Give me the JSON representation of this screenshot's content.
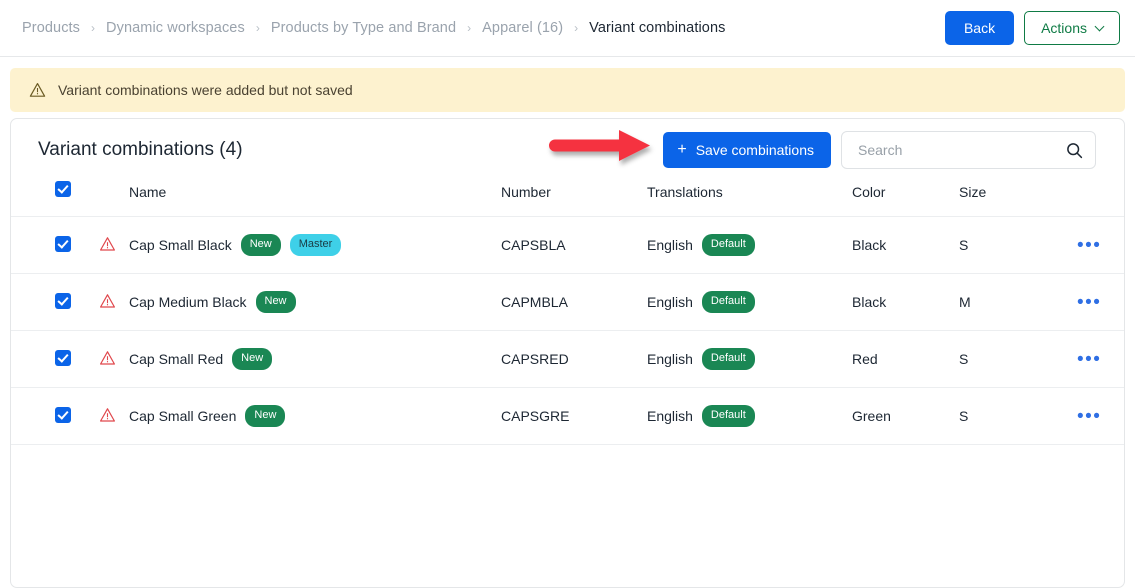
{
  "breadcrumb": {
    "items": [
      {
        "label": "Products",
        "current": false
      },
      {
        "label": "Dynamic workspaces",
        "current": false
      },
      {
        "label": "Products by Type and Brand",
        "current": false
      },
      {
        "label": "Apparel (16)",
        "current": false
      },
      {
        "label": "Variant combinations",
        "current": true
      }
    ],
    "separator": "›"
  },
  "topbar": {
    "back_label": "Back",
    "actions_label": "Actions",
    "chevron_icon": "chevron-down-icon"
  },
  "banner": {
    "icon": "warning-triangle-icon",
    "message": "Variant combinations were added but not saved",
    "background": "#fdf2cf"
  },
  "card": {
    "title": "Variant combinations (4)",
    "save_button": {
      "label": "Save combinations",
      "plus_icon": "plus-icon",
      "color": "#0b64e8"
    },
    "search": {
      "placeholder": "Search",
      "value": "",
      "icon": "search-icon"
    }
  },
  "annotation": {
    "arrow": "red-arrow-pointing-right",
    "color": "#f5333f"
  },
  "table": {
    "select_all_checked": true,
    "columns": [
      "Name",
      "Number",
      "Translations",
      "Color",
      "Size"
    ],
    "rows": [
      {
        "checked": true,
        "warning_icon": "warning-triangle-icon",
        "name": "Cap Small Black",
        "badges": [
          {
            "label": "New",
            "type": "new"
          },
          {
            "label": "Master",
            "type": "master"
          }
        ],
        "number": "CAPSBLA",
        "translation": "English",
        "translation_badge": "Default",
        "color": "Black",
        "size": "S",
        "menu_icon": "overflow-menu-icon"
      },
      {
        "checked": true,
        "warning_icon": "warning-triangle-icon",
        "name": "Cap Medium Black",
        "badges": [
          {
            "label": "New",
            "type": "new"
          }
        ],
        "number": "CAPMBLA",
        "translation": "English",
        "translation_badge": "Default",
        "color": "Black",
        "size": "M",
        "menu_icon": "overflow-menu-icon"
      },
      {
        "checked": true,
        "warning_icon": "warning-triangle-icon",
        "name": "Cap Small Red",
        "badges": [
          {
            "label": "New",
            "type": "new"
          }
        ],
        "number": "CAPSRED",
        "translation": "English",
        "translation_badge": "Default",
        "color": "Red",
        "size": "S",
        "menu_icon": "overflow-menu-icon"
      },
      {
        "checked": true,
        "warning_icon": "warning-triangle-icon",
        "name": "Cap Small Green",
        "badges": [
          {
            "label": "New",
            "type": "new"
          }
        ],
        "number": "CAPSGRE",
        "translation": "English",
        "translation_badge": "Default",
        "color": "Green",
        "size": "S",
        "menu_icon": "overflow-menu-icon"
      }
    ],
    "menu_glyph": "•••"
  }
}
